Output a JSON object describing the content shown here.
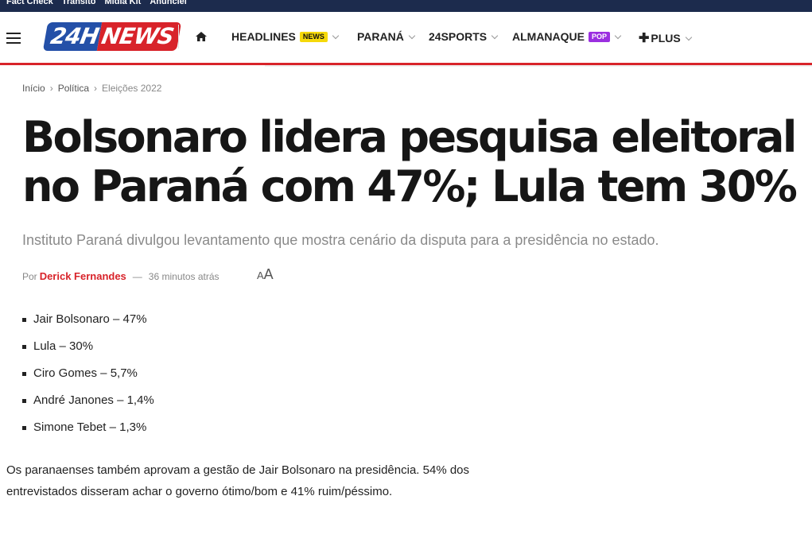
{
  "topbar": {
    "links": [
      "Fact Check",
      "Trânsito",
      "Mídia Kit",
      "Anunciel"
    ]
  },
  "logo": {
    "part1": "24H",
    "part2": "NEWS"
  },
  "nav": {
    "headlines": "HEADLINES",
    "headlines_badge": "NEWS",
    "parana": "PARANÁ",
    "sports": "24SPORTS",
    "almanaque": "ALMANAQUE",
    "almanaque_badge": "POP",
    "plus": "PLUS"
  },
  "breadcrumb": {
    "home": "Início",
    "section": "Política",
    "current": "Eleições 2022"
  },
  "article": {
    "title": "Bolsonaro lidera pesquisa eleitoral no Paraná com 47%; Lula tem 30%",
    "subtitle": "Instituto Paraná divulgou levantamento que mostra cenário da disputa para a presidência no estado.",
    "by": "Por",
    "author": "Derick Fernandes",
    "dash": "—",
    "time": "36 minutos atrás",
    "font_small": "A",
    "font_big": "A",
    "results": [
      "Jair Bolsonaro – 47%",
      "Lula – 30%",
      "Ciro Gomes – 5,7%",
      "André Janones – 1,4%",
      "Simone Tebet – 1,3%"
    ],
    "paragraph": "Os paranaenses também aprovam a gestão de Jair Bolsonaro na presidência. 54% dos entrevistados disseram achar o governo ótimo/bom e 41% ruim/péssimo."
  },
  "colors": {
    "topbar": "#1c2b4d",
    "accent": "#d8232a",
    "logo_blue": "#2450a8",
    "badge_news": "#f5d90a",
    "badge_pop": "#9b2fe0"
  },
  "icons": [
    "hamburger-menu-icon",
    "home-icon",
    "chevron-down-icon",
    "plus-icon"
  ]
}
